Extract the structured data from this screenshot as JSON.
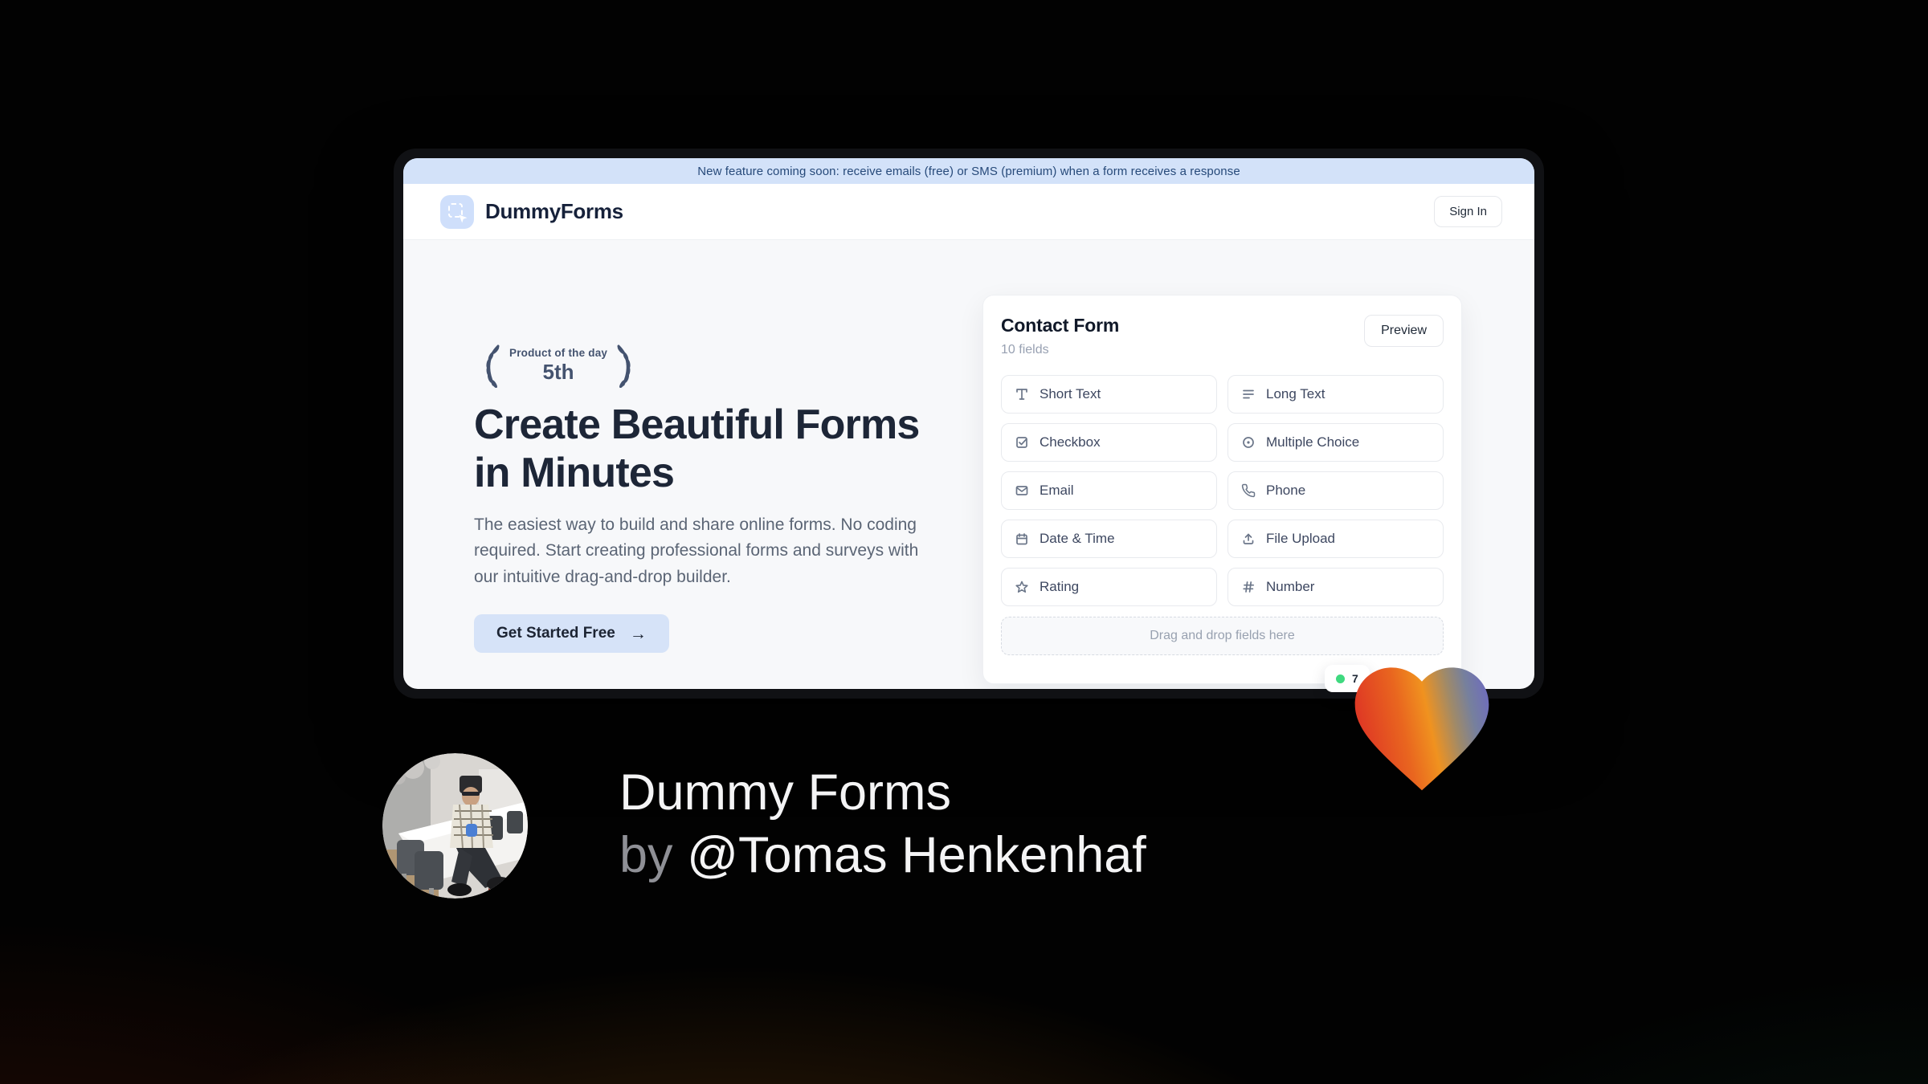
{
  "banner": {
    "text": "New feature coming soon: receive emails (free) or SMS (premium) when a form receives a response"
  },
  "nav": {
    "brand": "DummyForms",
    "sign_in_label": "Sign In"
  },
  "hero": {
    "badge": {
      "line1": "Product of the day",
      "line2": "5th"
    },
    "headline": "Create Beautiful Forms in Minutes",
    "subtext": "The easiest way to build and share online forms. No coding required. Start creating professional forms and surveys with our intuitive drag-and-drop builder.",
    "cta_label": "Get Started Free",
    "cta_arrow": "→"
  },
  "builder": {
    "title": "Contact Form",
    "field_count": "10 fields",
    "preview_label": "Preview",
    "fields": [
      {
        "label": "Short Text",
        "icon": "short-text-icon"
      },
      {
        "label": "Long Text",
        "icon": "long-text-icon"
      },
      {
        "label": "Checkbox",
        "icon": "checkbox-icon"
      },
      {
        "label": "Multiple Choice",
        "icon": "multiple-choice-icon"
      },
      {
        "label": "Email",
        "icon": "email-icon"
      },
      {
        "label": "Phone",
        "icon": "phone-icon"
      },
      {
        "label": "Date & Time",
        "icon": "calendar-icon"
      },
      {
        "label": "File Upload",
        "icon": "upload-icon"
      },
      {
        "label": "Rating",
        "icon": "star-icon"
      },
      {
        "label": "Number",
        "icon": "hash-icon"
      }
    ],
    "dropzone_text": "Drag and drop fields here",
    "status_badge": {
      "text": "7",
      "dot_color": "#3fd97f"
    }
  },
  "footer": {
    "title": "Dummy Forms",
    "byline_prefix": "by",
    "byline_name": "@Tomas Henkenhaf"
  },
  "colors": {
    "banner_bg": "#d3e2f9",
    "banner_text": "#274a7a",
    "accent_light_blue": "#d6e3f8",
    "headline_navy": "#1d2637",
    "laurel_navy": "#44536f",
    "status_green": "#3fd97f",
    "heart_gradient": [
      "#df3a24",
      "#ee7d1e",
      "#f0921f",
      "#76809d",
      "#6d68c4"
    ]
  }
}
